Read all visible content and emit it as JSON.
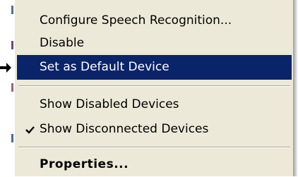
{
  "context_menu": {
    "items": [
      {
        "label": "Configure Speech Recognition..."
      },
      {
        "label": "Disable"
      },
      {
        "label": "Set as Default Device"
      },
      {
        "label": "Show Disabled Devices"
      },
      {
        "label": "Show Disconnected Devices",
        "checked": true
      },
      {
        "label": "Properties..."
      }
    ],
    "highlighted_item": "Set as Default Device",
    "colors": {
      "menu_background": "#ece9d8",
      "highlight_background": "#0a246a",
      "highlight_text": "#ffffff"
    }
  },
  "icons": {
    "pointer": "arrow-pointer-icon",
    "checkmark": "checkmark-icon"
  }
}
